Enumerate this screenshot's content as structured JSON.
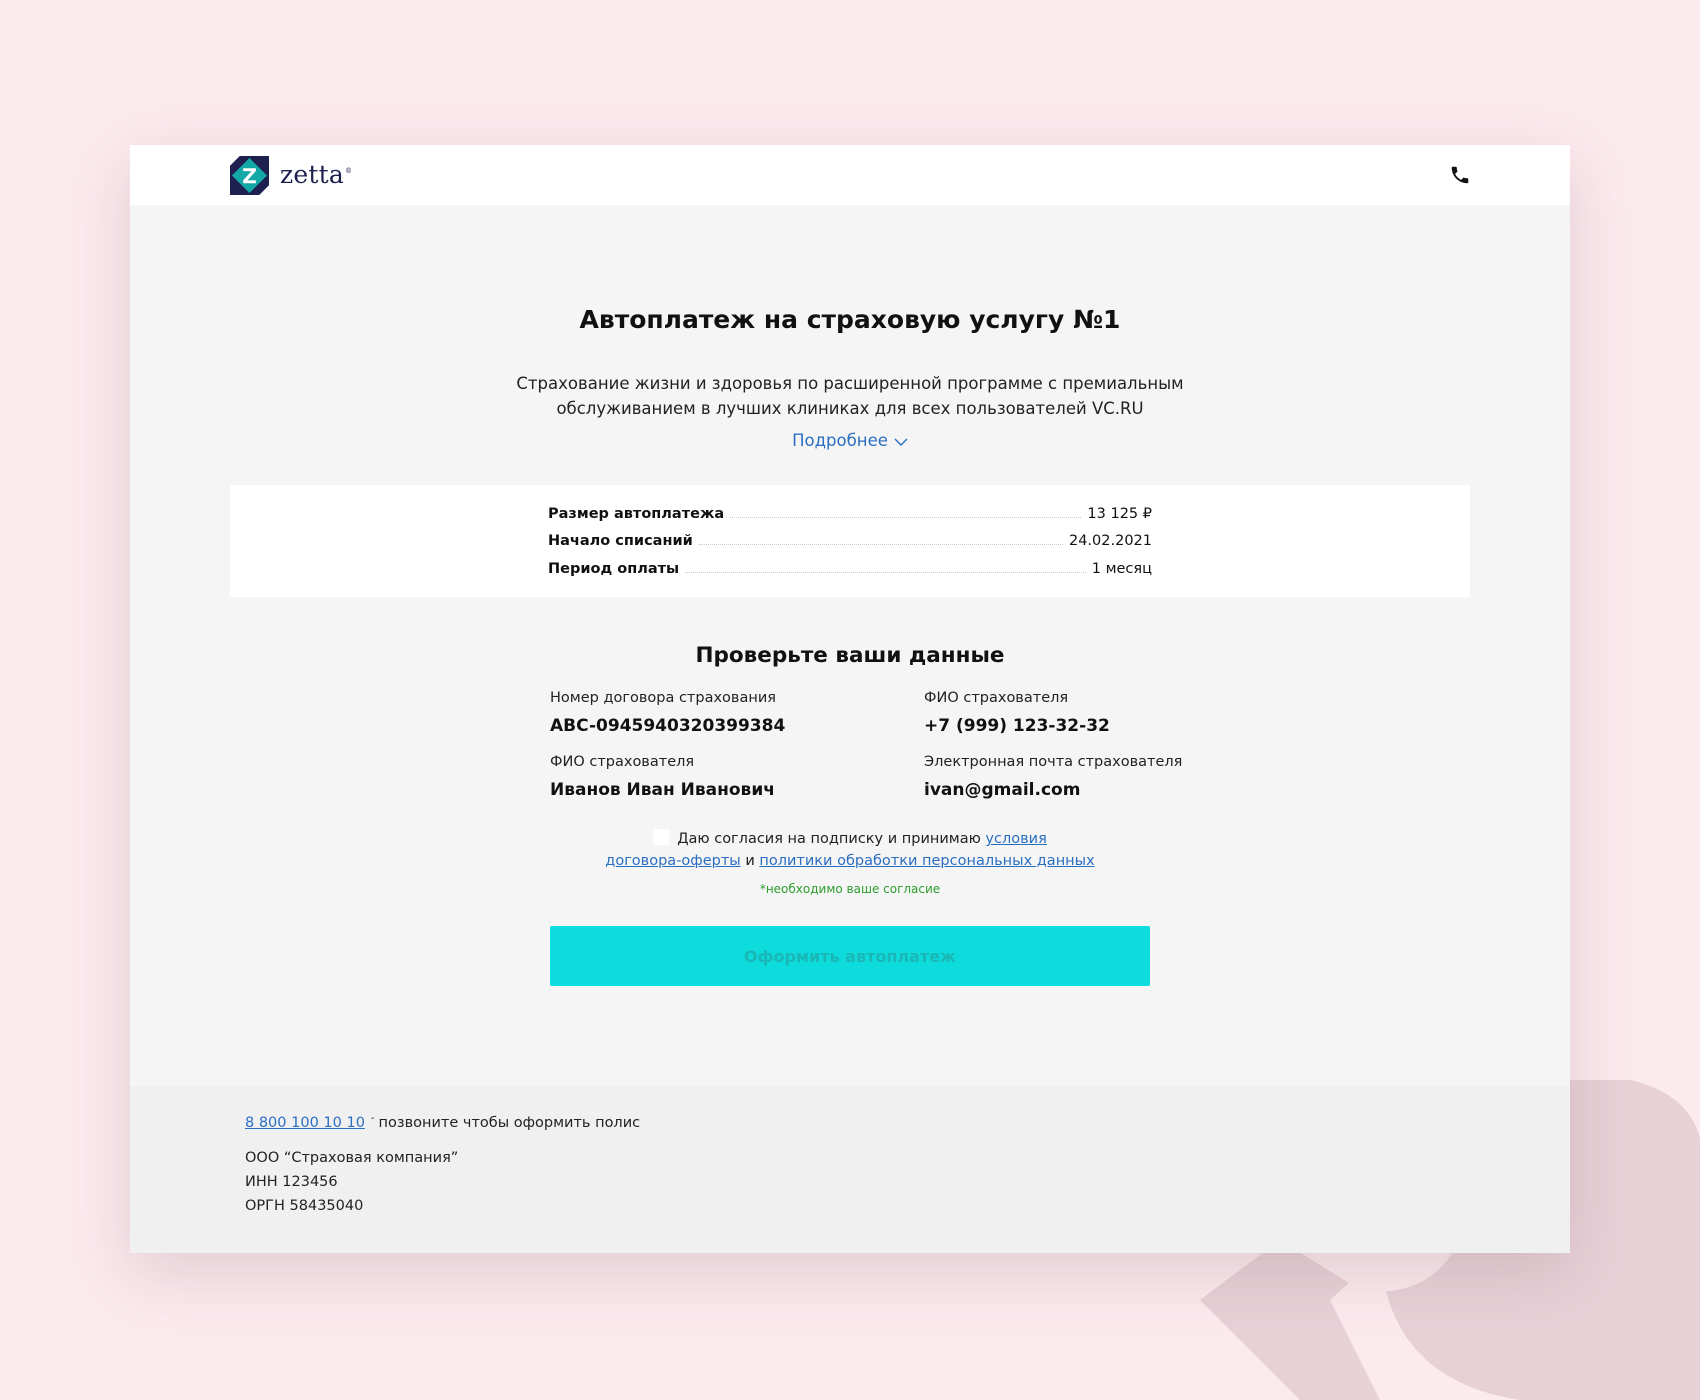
{
  "brand": {
    "name": "zetta",
    "reg_mark": "®"
  },
  "header": {
    "phone_icon": "phone-icon"
  },
  "main": {
    "title": "Автоплатеж на страховую услугу №1",
    "description": "Страхование жизни и здоровья по расширенной программе с премиальным обслуживанием в лучших клиниках для всех пользователей VC.RU",
    "more_link": "Подробнее",
    "more_icon": "chevron-down-icon"
  },
  "summary": [
    {
      "label": "Размер автоплатежа",
      "value": "13 125 ₽"
    },
    {
      "label": "Начало списаний",
      "value": "24.02.2021"
    },
    {
      "label": "Период оплаты",
      "value": "1 месяц"
    }
  ],
  "check": {
    "title": "Проверьте ваши данные",
    "fields": [
      {
        "label": "Номер договора страхования",
        "value": "ABC-0945940320399384"
      },
      {
        "label": "ФИО страхователя",
        "value": "+7 (999) 123-32-32"
      },
      {
        "label": "ФИО страхователя",
        "value": "Иванов Иван Иванович"
      },
      {
        "label": "Электронная почта страхователя",
        "value": "ivan@gmail.com"
      }
    ]
  },
  "consent": {
    "text_before": "Даю согласия на подписку и принимаю",
    "link1_a": "условия",
    "link1_b": "договора-оферты",
    "conjunction": "и",
    "link2": "политики обработки персональных данных",
    "hint": "*необходимо ваше согласие"
  },
  "submit": {
    "label": "Оформить автоплатеж"
  },
  "footer": {
    "phone": "8 800 100 10 10",
    "dash": "-",
    "phone_note": "позвоните чтобы оформить полис",
    "company": "ООО “Страховая компания”",
    "inn": "ИНН 123456",
    "ogrn": "ОРГН 58435040"
  },
  "colors": {
    "page_bg": "#fbeaee",
    "accent": "#0edbdb",
    "link": "#2a6ec2",
    "hint": "#2e9e2e",
    "brand_navy": "#1e2150",
    "brand_teal": "#14a7a7"
  }
}
